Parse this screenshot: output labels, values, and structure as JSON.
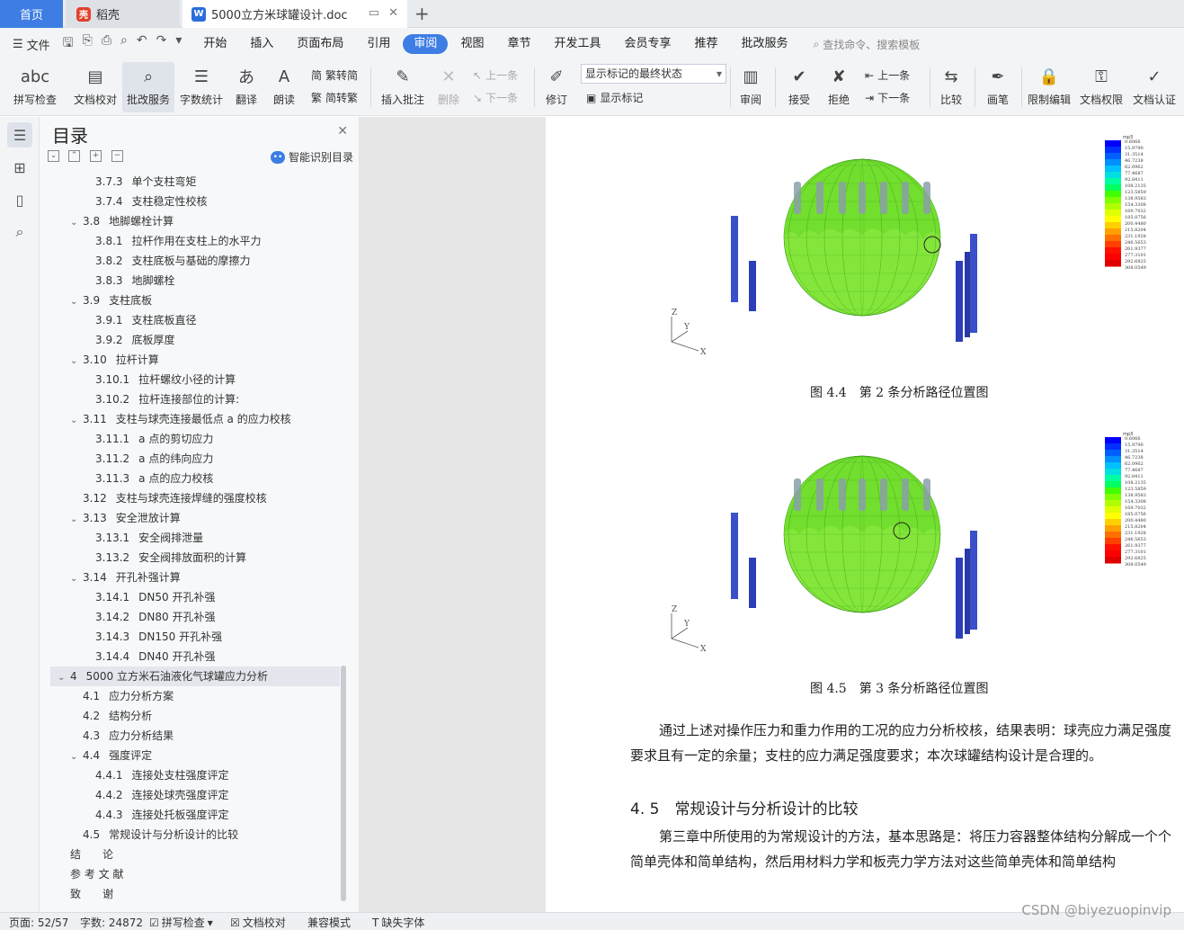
{
  "tabs": {
    "home": "首页",
    "daoke": "稻壳",
    "doc": "5000立方米球罐设计.doc"
  },
  "menu": {
    "file": "文件",
    "items": [
      "开始",
      "插入",
      "页面布局",
      "引用",
      "审阅",
      "视图",
      "章节",
      "开发工具",
      "会员专享",
      "推荐",
      "批改服务"
    ],
    "active": "审阅",
    "search": "查找命令、搜索模板"
  },
  "ribbon": {
    "spellcheck": "拼写检查",
    "doccheck": "文档校对",
    "correction": "批改服务",
    "wordcount": "字数统计",
    "translate": "翻译",
    "read": "朗读",
    "trad": "繁转简",
    "simp": "简转繁",
    "insert_comment": "插入批注",
    "delete": "删除",
    "prev": "上一条",
    "next": "下一条",
    "revise": "修订",
    "markup_state": "显示标记的最终状态",
    "show_markup": "显示标记",
    "review": "审阅",
    "accept": "接受",
    "reject": "拒绝",
    "prev2": "上一条",
    "next2": "下一条",
    "compare": "比较",
    "pen": "画笔",
    "restrict": "限制编辑",
    "permission": "文档权限",
    "certify": "文档认证"
  },
  "toc": {
    "title": "目录",
    "smart": "智能识别目录",
    "items": [
      {
        "level": 3,
        "num": "3.7.3",
        "text": "单个支柱弯矩"
      },
      {
        "level": 3,
        "num": "3.7.4",
        "text": "支柱稳定性校核"
      },
      {
        "level": 2,
        "num": "3.8",
        "text": "地脚螺栓计算",
        "exp": true
      },
      {
        "level": 3,
        "num": "3.8.1",
        "text": "拉杆作用在支柱上的水平力"
      },
      {
        "level": 3,
        "num": "3.8.2",
        "text": "支柱底板与基础的摩擦力"
      },
      {
        "level": 3,
        "num": "3.8.3",
        "text": "地脚螺栓"
      },
      {
        "level": 2,
        "num": "3.9",
        "text": "支柱底板",
        "exp": true
      },
      {
        "level": 3,
        "num": "3.9.1",
        "text": "支柱底板直径"
      },
      {
        "level": 3,
        "num": "3.9.2",
        "text": "底板厚度"
      },
      {
        "level": 2,
        "num": "3.10",
        "text": "拉杆计算",
        "exp": true
      },
      {
        "level": 3,
        "num": "3.10.1",
        "text": "拉杆螺纹小径的计算"
      },
      {
        "level": 3,
        "num": "3.10.2",
        "text": "拉杆连接部位的计算:"
      },
      {
        "level": 2,
        "num": "3.11",
        "text": "支柱与球壳连接最低点 a 的应力校核",
        "exp": true
      },
      {
        "level": 3,
        "num": "3.11.1",
        "text": "a 点的剪切应力"
      },
      {
        "level": 3,
        "num": "3.11.2",
        "text": "a 点的纬向应力"
      },
      {
        "level": 3,
        "num": "3.11.3",
        "text": "a 点的应力校核"
      },
      {
        "level": 2,
        "num": "3.12",
        "text": "支柱与球壳连接焊缝的强度校核"
      },
      {
        "level": 2,
        "num": "3.13",
        "text": "安全泄放计算",
        "exp": true
      },
      {
        "level": 3,
        "num": "3.13.1",
        "text": "安全阀排泄量"
      },
      {
        "level": 3,
        "num": "3.13.2",
        "text": "安全阀排放面积的计算"
      },
      {
        "level": 2,
        "num": "3.14",
        "text": "开孔补强计算",
        "exp": true
      },
      {
        "level": 3,
        "num": "3.14.1",
        "text": "DN50 开孔补强"
      },
      {
        "level": 3,
        "num": "3.14.2",
        "text": "DN80 开孔补强"
      },
      {
        "level": 3,
        "num": "3.14.3",
        "text": "DN150 开孔补强"
      },
      {
        "level": 3,
        "num": "3.14.4",
        "text": "DN40 开孔补强"
      },
      {
        "level": 1,
        "num": "4",
        "text": "5000 立方米石油液化气球罐应力分析",
        "exp": true,
        "sel": true
      },
      {
        "level": 2,
        "num": "4.1",
        "text": "应力分析方案"
      },
      {
        "level": 2,
        "num": "4.2",
        "text": "结构分析"
      },
      {
        "level": 2,
        "num": "4.3",
        "text": "应力分析结果"
      },
      {
        "level": 2,
        "num": "4.4",
        "text": "强度评定",
        "exp": true
      },
      {
        "level": 3,
        "num": "4.4.1",
        "text": "连接处支柱强度评定"
      },
      {
        "level": 3,
        "num": "4.4.2",
        "text": "连接处球壳强度评定"
      },
      {
        "level": 3,
        "num": "4.4.3",
        "text": "连接处托板强度评定"
      },
      {
        "level": 2,
        "num": "4.5",
        "text": "常规设计与分析设计的比较"
      },
      {
        "level": 1,
        "num": "",
        "text": "结　　论"
      },
      {
        "level": 1,
        "num": "",
        "text": "参 考 文 献"
      },
      {
        "level": 1,
        "num": "",
        "text": "致　　谢"
      }
    ]
  },
  "doc": {
    "fig1_caption": "图 4.4　第 2 条分析路径位置图",
    "fig2_caption": "图 4.5　第 3 条分析路径位置图",
    "legend_title": "mp3",
    "legend_values": [
      "0.6066",
      "15.9790",
      "31.3514",
      "46.7238",
      "62.0962",
      "77.4687",
      "92.8411",
      "108.2135",
      "123.5859",
      "138.9583",
      "154.3308",
      "169.7032",
      "185.0756",
      "200.4480",
      "215.8204",
      "231.1928",
      "246.5653",
      "261.9377",
      "277.3101",
      "292.6825",
      "308.0549"
    ],
    "axis_z": "Z",
    "axis_y": "Y",
    "axis_x": "X",
    "para1": "通过上述对操作压力和重力作用的工况的应力分析校核，结果表明：球壳应力满足强度要求且有一定的余量；支柱的应力满足强度要求；本次球罐结构设计是合理的。",
    "heading": "4. 5　常规设计与分析设计的比较",
    "para2": "第三章中所使用的为常规设计的方法，基本思路是：将压力容器整体结构分解成一个个简单壳体和简单结构，然后用材料力学和板壳力学方法对这些简单壳体和简单结构"
  },
  "status": {
    "page": "页面: 52/57",
    "words": "字数: 24872",
    "spell": "拼写检查",
    "check": "文档校对",
    "compat": "兼容模式",
    "font": "缺失字体"
  },
  "watermark": "CSDN @biyezuopinvip"
}
